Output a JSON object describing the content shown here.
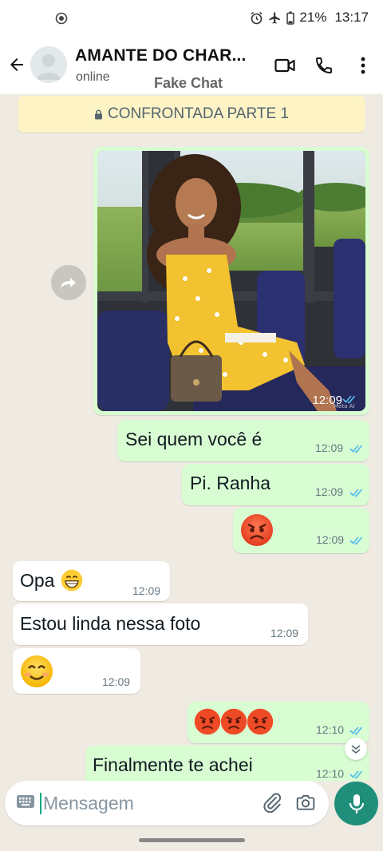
{
  "status_bar": {
    "battery": "21%",
    "time": "13:17"
  },
  "header": {
    "contact_name": "AMANTE DO CHAR...",
    "status": "online",
    "watermark": "Fake Chat"
  },
  "chat": {
    "banner": "CONFRONTADA PARTE 1",
    "image_message": {
      "time": "12:09",
      "image_credit": "Meta AI"
    },
    "messages": [
      {
        "text": "Sei quem você é",
        "time": "12:09"
      },
      {
        "text": "Pi. Ranha",
        "time": "12:09"
      },
      {
        "emoji": "angry-face",
        "time": "12:09"
      },
      {
        "text": "Opa",
        "emoji": "grinning-face",
        "time": "12:09"
      },
      {
        "text": "Estou linda nessa foto",
        "time": "12:09"
      },
      {
        "emoji": "smiling-face",
        "time": "12:09"
      },
      {
        "emoji": "angry-face x3",
        "time": "12:10"
      },
      {
        "text": "Finalmente te achei",
        "time": "12:10"
      }
    ]
  },
  "input": {
    "placeholder": "Mensagem"
  },
  "colors": {
    "outgoing": "#d9fdd3",
    "incoming": "#ffffff",
    "accent": "#1f8f7a",
    "tick": "#53bdeb",
    "banner": "#fdf3c5"
  }
}
